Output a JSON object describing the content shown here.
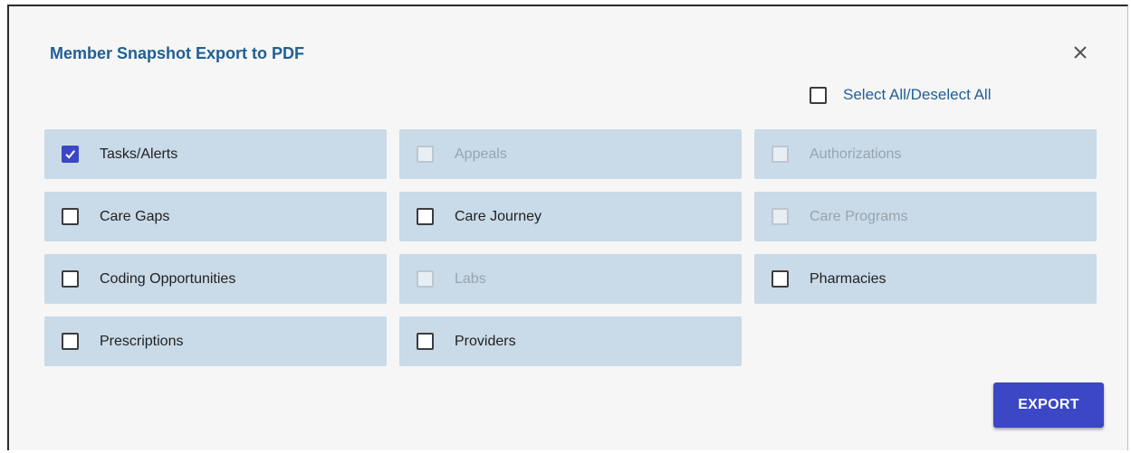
{
  "dialog": {
    "title": "Member Snapshot Export to PDF",
    "select_all_label": "Select All/Deselect All",
    "export_label": "EXPORT",
    "close_icon": "close-icon"
  },
  "colors": {
    "accent": "#3b47c4",
    "title": "#1f5f95",
    "cell_background": "#c9dae8"
  },
  "options": [
    {
      "label": "Tasks/Alerts",
      "checked": true,
      "disabled": false
    },
    {
      "label": "Appeals",
      "checked": false,
      "disabled": true
    },
    {
      "label": "Authorizations",
      "checked": false,
      "disabled": true
    },
    {
      "label": "Care Gaps",
      "checked": false,
      "disabled": false
    },
    {
      "label": "Care Journey",
      "checked": false,
      "disabled": false
    },
    {
      "label": "Care Programs",
      "checked": false,
      "disabled": true
    },
    {
      "label": "Coding Opportunities",
      "checked": false,
      "disabled": false
    },
    {
      "label": "Labs",
      "checked": false,
      "disabled": true
    },
    {
      "label": "Pharmacies",
      "checked": false,
      "disabled": false
    },
    {
      "label": "Prescriptions",
      "checked": false,
      "disabled": false
    },
    {
      "label": "Providers",
      "checked": false,
      "disabled": false
    }
  ]
}
